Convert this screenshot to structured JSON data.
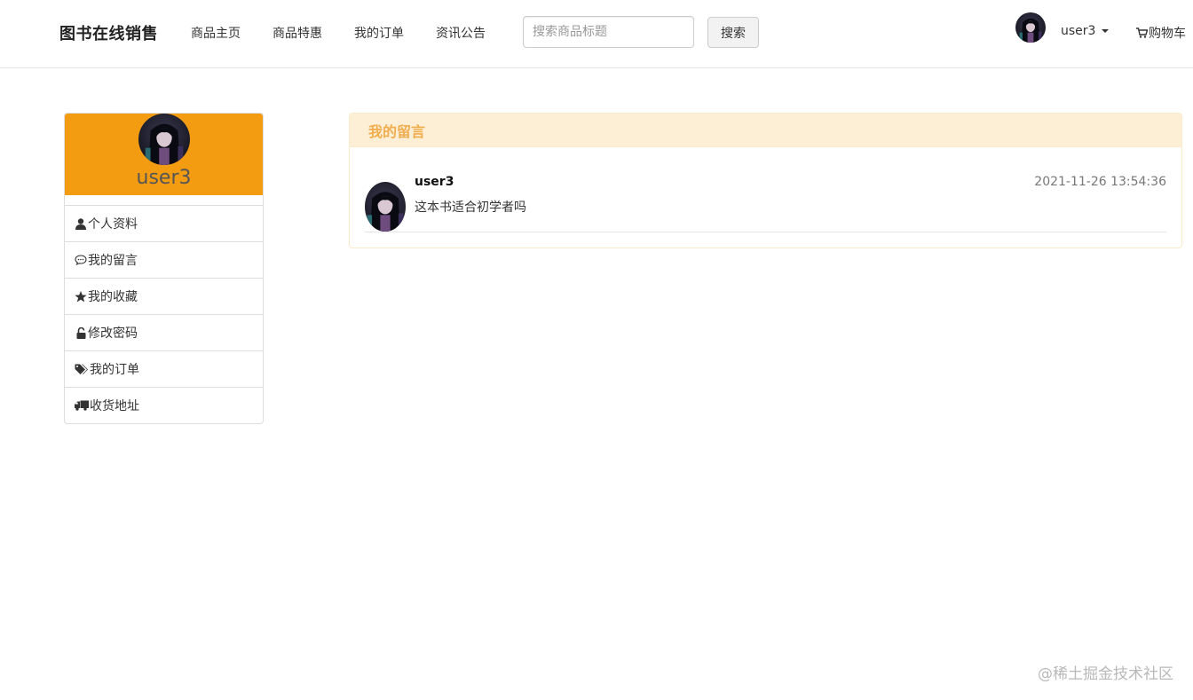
{
  "navbar": {
    "brand": "图书在线销售",
    "links": [
      "商品主页",
      "商品特惠",
      "我的订单",
      "资讯公告"
    ],
    "search_placeholder": "搜索商品标题",
    "search_button": "搜索",
    "username": "user3",
    "cart_label": "购物车"
  },
  "sidebar": {
    "username": "user3",
    "header_color": "#f39c12",
    "items": [
      {
        "label": "个人资料",
        "icon": "user-icon"
      },
      {
        "label": "我的留言",
        "icon": "comment-icon"
      },
      {
        "label": "我的收藏",
        "icon": "star-icon"
      },
      {
        "label": "修改密码",
        "icon": "unlock-icon"
      },
      {
        "label": "我的订单",
        "icon": "tags-icon"
      },
      {
        "label": "收货地址",
        "icon": "truck-icon"
      }
    ]
  },
  "panel": {
    "title": "我的留言",
    "messages": [
      {
        "user": "user3",
        "time": "2021-11-26 13:54:36",
        "text": "这本书适合初学者吗"
      }
    ]
  },
  "watermark": "@稀土掘金技术社区",
  "colors": {
    "accent": "#f0ad4e",
    "panel_bg": "#fcefd6"
  }
}
